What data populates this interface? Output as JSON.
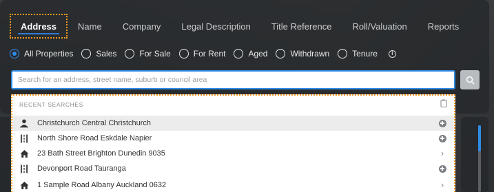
{
  "tabs": [
    {
      "label": "Address",
      "active": true
    },
    {
      "label": "Name",
      "active": false
    },
    {
      "label": "Company",
      "active": false
    },
    {
      "label": "Legal Description",
      "active": false
    },
    {
      "label": "Title Reference",
      "active": false
    },
    {
      "label": "Roll/Valuation",
      "active": false
    },
    {
      "label": "Reports",
      "active": false
    }
  ],
  "filters": [
    {
      "label": "All Properties",
      "checked": true
    },
    {
      "label": "Sales",
      "checked": false
    },
    {
      "label": "For Sale",
      "checked": false
    },
    {
      "label": "For Rent",
      "checked": false
    },
    {
      "label": "Aged",
      "checked": false
    },
    {
      "label": "Withdrawn",
      "checked": false
    },
    {
      "label": "Tenure",
      "checked": false
    }
  ],
  "search": {
    "placeholder": "Search for an address, street name, suburb or council area",
    "value": ""
  },
  "recent": {
    "header": "RECENT SEARCHES",
    "items": [
      {
        "label": "Christchurch Central Christchurch",
        "icon": "person-location-icon",
        "action": "add-icon"
      },
      {
        "label": "North Shore Road Eskdale Napier",
        "icon": "road-icon",
        "action": "add-icon"
      },
      {
        "label": "23 Bath Street Brighton Dunedin 9035",
        "icon": "house-icon",
        "action": "chevron-right-icon"
      },
      {
        "label": "Devonport Road Tauranga",
        "icon": "road-icon",
        "action": "add-icon"
      },
      {
        "label": "1 Sample Road Albany Auckland 0632",
        "icon": "house-icon",
        "action": "chevron-right-icon"
      }
    ]
  },
  "colors": {
    "accent": "#2f8be6",
    "focus_outline": "#f59a23"
  }
}
